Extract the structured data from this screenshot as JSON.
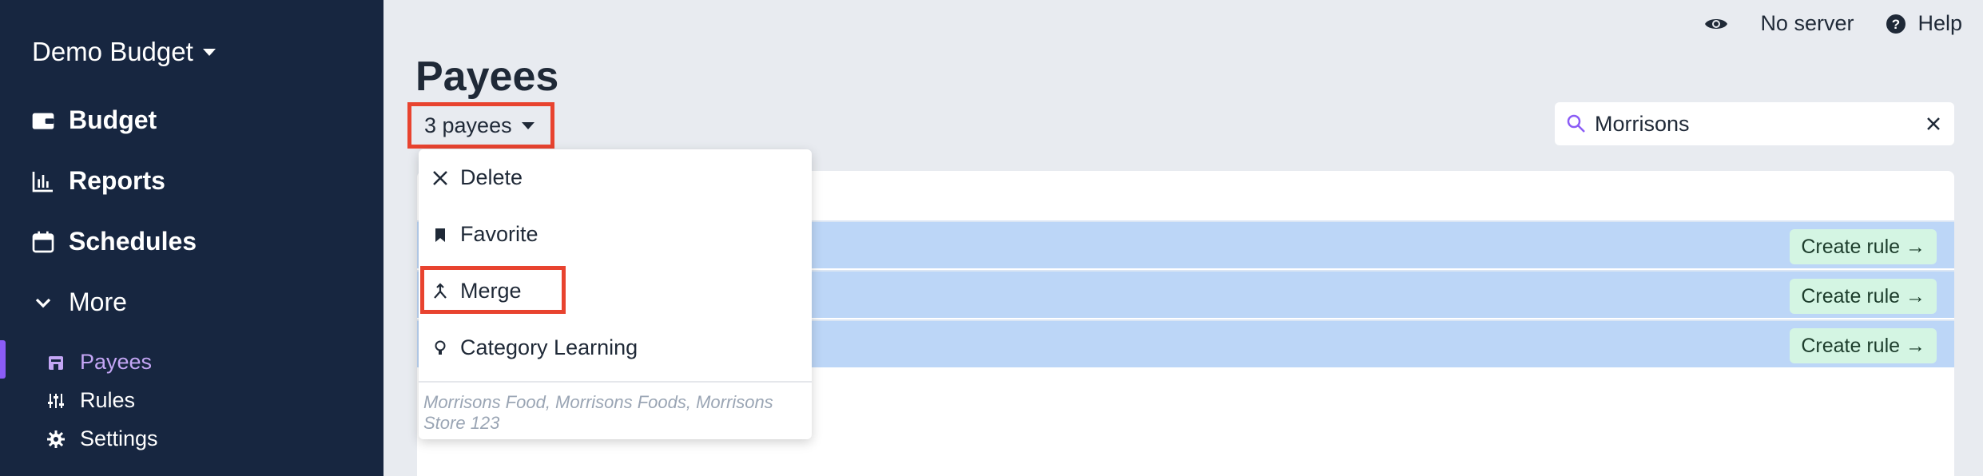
{
  "sidebar": {
    "budget_name": "Demo Budget",
    "nav": [
      {
        "label": "Budget",
        "icon": "wallet-icon"
      },
      {
        "label": "Reports",
        "icon": "bar-chart-icon"
      },
      {
        "label": "Schedules",
        "icon": "calendar-icon"
      },
      {
        "label": "More",
        "icon": "chevron-down-icon"
      }
    ],
    "sub": [
      {
        "label": "Payees",
        "icon": "store-icon",
        "active": true
      },
      {
        "label": "Rules",
        "icon": "sliders-icon"
      },
      {
        "label": "Settings",
        "icon": "gear-icon"
      }
    ]
  },
  "topbar": {
    "server_label": "No server",
    "help_label": "Help"
  },
  "page": {
    "title": "Payees",
    "selection_label": "3 payees"
  },
  "search": {
    "value": "Morrisons"
  },
  "menu": {
    "items": [
      {
        "label": "Delete",
        "icon": "close-icon"
      },
      {
        "label": "Favorite",
        "icon": "bookmark-icon"
      },
      {
        "label": "Merge",
        "icon": "merge-icon"
      },
      {
        "label": "Category Learning",
        "icon": "lightbulb-icon"
      }
    ],
    "footer": "Morrisons Food, Morrisons Foods, Morrisons Store 123"
  },
  "rows": [
    {
      "action": "Create rule →"
    },
    {
      "action": "Create rule →"
    },
    {
      "action": "Create rule →"
    }
  ],
  "colors": {
    "sidebar_bg": "#172640",
    "accent": "#8b5cf6",
    "highlight_border": "#e8432f",
    "selected_row": "#bcd6f7",
    "create_rule_bg": "#d4f5e3"
  }
}
